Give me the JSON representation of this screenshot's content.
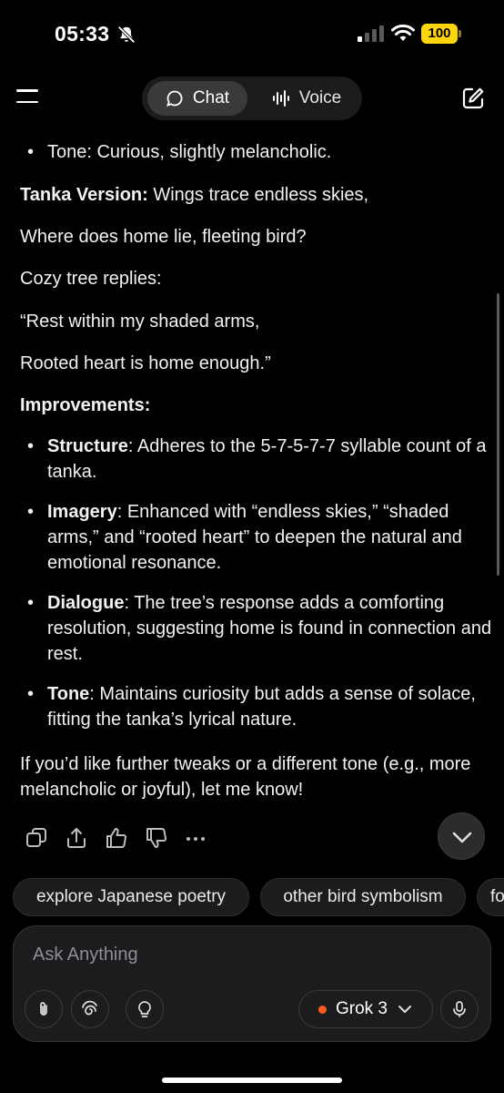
{
  "status_bar": {
    "time": "05:33",
    "battery": "100"
  },
  "header": {
    "chat_label": "Chat",
    "voice_label": "Voice"
  },
  "message": {
    "tone_bullet": "Tone: Curious, slightly melancholic.",
    "tanka_heading": "Tanka Version:",
    "tanka_line1": " Wings trace endless skies,",
    "tanka_line2": "Where does home lie, fleeting bird?",
    "tanka_line3": "Cozy tree replies:",
    "tanka_line4": "“Rest within my shaded arms,",
    "tanka_line5": "Rooted heart is home enough.”",
    "improvements_heading": "Improvements:",
    "improvements": [
      {
        "term": "Structure",
        "text": ": Adheres to the 5-7-5-7-7 syllable count of a tanka."
      },
      {
        "term": "Imagery",
        "text": ": Enhanced with “endless skies,” “shaded arms,” and “rooted heart” to deepen the natural and emotional resonance."
      },
      {
        "term": "Dialogue",
        "text": ": The tree’s response adds a comforting resolution, suggesting home is found in connection and rest."
      },
      {
        "term": "Tone",
        "text": ": Maintains curiosity but adds a sense of solace, fitting the tanka’s lyrical nature."
      }
    ],
    "closing": "If you’d like further tweaks or a different tone (e.g., more melancholic or joyful), let me know!"
  },
  "suggestions": [
    "explore Japanese poetry",
    "other bird symbolism",
    "fo"
  ],
  "composer": {
    "placeholder": "Ask Anything",
    "model": "Grok 3"
  },
  "colors": {
    "background": "#000000",
    "accent_dot": "#ff5a1f",
    "battery": "#ffd60a"
  }
}
